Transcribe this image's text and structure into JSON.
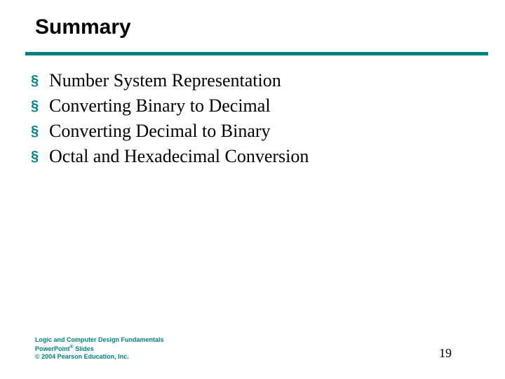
{
  "title": "Summary",
  "bullets": [
    "Number System Representation",
    "Converting Binary to Decimal",
    "Converting Decimal to Binary",
    "Octal and Hexadecimal Conversion"
  ],
  "footer": {
    "line1": "Logic and Computer Design Fundamentals",
    "line2_a": "PowerPoint",
    "line2_b": " Slides",
    "line3": "© 2004 Pearson Education, Inc."
  },
  "page_number": "19",
  "bullet_glyph": "§"
}
